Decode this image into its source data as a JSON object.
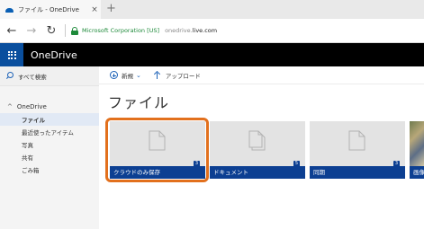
{
  "browser": {
    "tab_title": "ファイル - OneDrive",
    "tab_close": "×",
    "new_tab": "+",
    "back": "←",
    "forward": "→",
    "refresh": "↻",
    "cert_label": "Microsoft Corporation [US]",
    "url_prefix": "onedrive.",
    "url_domain": "live.com"
  },
  "app": {
    "brand": "OneDrive"
  },
  "sidebar": {
    "search_label": "すべて検索",
    "root_label": "OneDrive",
    "items": [
      {
        "label": "ファイル"
      },
      {
        "label": "最近使ったアイテム"
      },
      {
        "label": "写真"
      },
      {
        "label": "共有"
      },
      {
        "label": "ごみ箱"
      }
    ]
  },
  "commands": {
    "new_label": "新規",
    "new_chevron": "⌄",
    "upload_label": "アップロード"
  },
  "main": {
    "title": "ファイル",
    "folders": [
      {
        "name": "クラウドのみ保存",
        "count": "3"
      },
      {
        "name": "ドキュメント",
        "count": "5"
      },
      {
        "name": "同期",
        "count": "3"
      },
      {
        "name": "画像",
        "count": ""
      }
    ]
  },
  "colors": {
    "suitebar": "#000000",
    "waffle": "#0a4f9e",
    "tile_footer": "#0c3f92",
    "highlight": "#e2701d",
    "nav_selected": "#e1e9f5"
  },
  "icons": {
    "tab": "onedrive-cloud-icon",
    "lock": "lock-icon",
    "waffle": "app-launcher-icon",
    "search": "search-icon",
    "new": "plus-icon",
    "upload": "upload-icon",
    "folder": "document-icon"
  }
}
